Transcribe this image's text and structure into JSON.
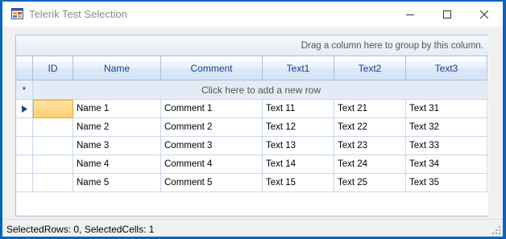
{
  "window": {
    "title": "Telerik Test Selection"
  },
  "grid": {
    "group_panel_text": "Drag a column here to group by this column.",
    "new_row_symbol": "*",
    "new_row_text": "Click here to add a new row",
    "columns": [
      "ID",
      "Name",
      "Comment",
      "Text1",
      "Text2",
      "Text3"
    ],
    "rows": [
      [
        "",
        "Name 1",
        "Comment 1",
        "Text 11",
        "Text 21",
        "Text 31"
      ],
      [
        "",
        "Name 2",
        "Comment 2",
        "Text 12",
        "Text 22",
        "Text 32"
      ],
      [
        "",
        "Name 3",
        "Comment 3",
        "Text 13",
        "Text 23",
        "Text 33"
      ],
      [
        "",
        "Name 4",
        "Comment 4",
        "Text 14",
        "Text 24",
        "Text 34"
      ],
      [
        "",
        "Name 5",
        "Comment 5",
        "Text 15",
        "Text 25",
        "Text 35"
      ]
    ],
    "current_row_icon": "current-row-arrow-icon"
  },
  "status": {
    "text": "SelectedRows: 0, SelectedCells: 1"
  },
  "colors": {
    "desktop": "#0563c1",
    "header_text": "#15428b",
    "current_cell": "#ffcf72"
  }
}
